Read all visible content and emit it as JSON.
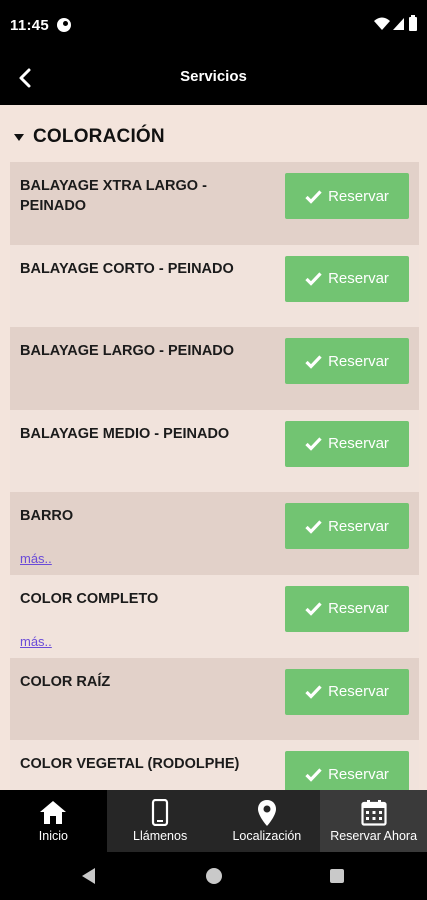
{
  "status_bar": {
    "time": "11:45"
  },
  "app_bar": {
    "title": "Servicios"
  },
  "section": {
    "label": "COLORACIÓN"
  },
  "services": [
    {
      "name": "BALAYAGE XTRA LARGO - PEINADO",
      "button": "Reservar",
      "more": ""
    },
    {
      "name": "BALAYAGE CORTO - PEINADO",
      "button": "Reservar",
      "more": ""
    },
    {
      "name": "BALAYAGE LARGO - PEINADO",
      "button": "Reservar",
      "more": ""
    },
    {
      "name": "BALAYAGE MEDIO - PEINADO",
      "button": "Reservar",
      "more": ""
    },
    {
      "name": "BARRO",
      "button": "Reservar",
      "more": "más.."
    },
    {
      "name": "COLOR COMPLETO",
      "button": "Reservar",
      "more": "más.."
    },
    {
      "name": "COLOR RAÍZ",
      "button": "Reservar",
      "more": ""
    },
    {
      "name": "COLOR VEGETAL (RODOLPHE)",
      "button": "Reservar",
      "more": ""
    }
  ],
  "bottom_nav": {
    "items": [
      {
        "label": "Inicio",
        "icon": "home-icon"
      },
      {
        "label": "Llámenos",
        "icon": "phone-icon"
      },
      {
        "label": "Localización",
        "icon": "location-pin-icon"
      },
      {
        "label": "Reservar Ahora",
        "icon": "calendar-icon"
      }
    ]
  },
  "colors": {
    "button": "#72c472",
    "background": "#f3e4dc",
    "row_alt": "#e2d1c9",
    "link": "#6a4bd8"
  }
}
